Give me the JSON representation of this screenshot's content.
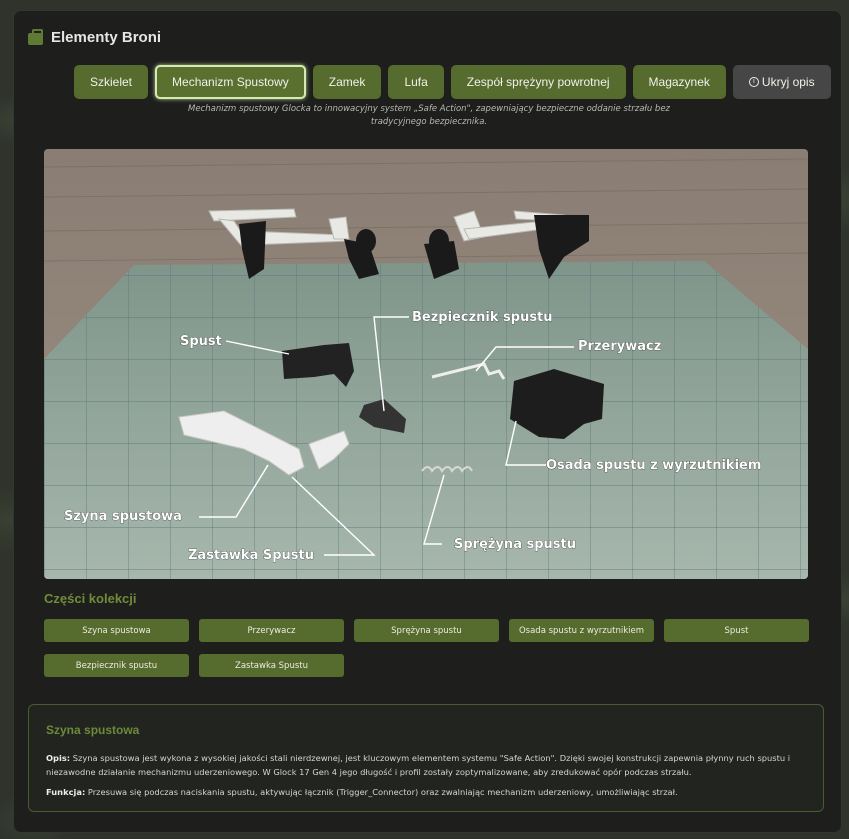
{
  "app": {
    "title": "Elementy Broni"
  },
  "tabs": [
    {
      "label": "Szkielet",
      "active": false
    },
    {
      "label": "Mechanizm Spustowy",
      "active": true
    },
    {
      "label": "Zamek",
      "active": false
    },
    {
      "label": "Lufa",
      "active": false
    },
    {
      "label": "Zespół sprężyny powrotnej",
      "active": false
    },
    {
      "label": "Magazynek",
      "active": false
    }
  ],
  "toggle_description": {
    "icon": "info-icon",
    "label": "Ukryj opis"
  },
  "section_description": "Mechanizm spustowy Glocka to innowacyjny system „Safe Action\", zapewniający bezpieczne oddanie strzału bez tradycyjnego bezpiecznika.",
  "photo_labels": {
    "spust": "Spust",
    "bezpiecznik": "Bezpiecznik spustu",
    "przerywacz": "Przerywacz",
    "osada": "Osada spustu z wyrzutnikiem",
    "szyna": "Szyna spustowa",
    "sprezyna": "Sprężyna spustu",
    "zastawka": "Zastawka Spustu"
  },
  "parts_section": {
    "title": "Części kolekcji",
    "items": [
      "Szyna spustowa",
      "Przerywacz",
      "Sprężyna spustu",
      "Osada spustu z wyrzutnikiem",
      "Spust",
      "Bezpiecznik spustu",
      "Zastawka Spustu"
    ]
  },
  "details": {
    "title": "Szyna spustowa",
    "opis_label": "Opis:",
    "opis_text": "Szyna spustowa jest wykona z wysokiej jakości stali nierdzewnej, jest kluczowym elementem systemu \"Safe Action\". Dzięki swojej konstrukcji zapewnia płynny ruch spustu i niezawodne działanie mechanizmu uderzeniowego. W Glock 17 Gen 4 jego długość i profil zostały zoptymalizowane, aby zredukować opór podczas strzału.",
    "funkcja_label": "Funkcja:",
    "funkcja_text": "Przesuwa się podczas naciskania spustu, aktywując łącznik (Trigger_Connector) oraz zwalniając mechanizm uderzeniowy, umożliwiając strzał."
  },
  "colors": {
    "accent": "#566b2e",
    "accent_text": "#6f8c3b",
    "panel": "#1e1f1d",
    "toggle": "#454645"
  }
}
